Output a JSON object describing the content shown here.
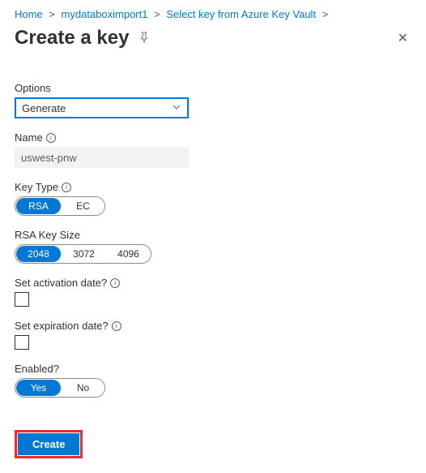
{
  "breadcrumb": {
    "home": "Home",
    "item1": "mydataboximport1",
    "item2": "Select key from Azure Key Vault"
  },
  "header": {
    "title": "Create a key"
  },
  "form": {
    "options": {
      "label": "Options",
      "selected": "Generate"
    },
    "name": {
      "label": "Name",
      "value": "uswest-pnw"
    },
    "keyType": {
      "label": "Key Type",
      "options": [
        "RSA",
        "EC"
      ],
      "selected": "RSA"
    },
    "rsaKeySize": {
      "label": "RSA Key Size",
      "options": [
        "2048",
        "3072",
        "4096"
      ],
      "selected": "2048"
    },
    "activation": {
      "label": "Set activation date?"
    },
    "expiration": {
      "label": "Set expiration date?"
    },
    "enabled": {
      "label": "Enabled?",
      "options": [
        "Yes",
        "No"
      ],
      "selected": "Yes"
    }
  },
  "footer": {
    "create": "Create"
  }
}
